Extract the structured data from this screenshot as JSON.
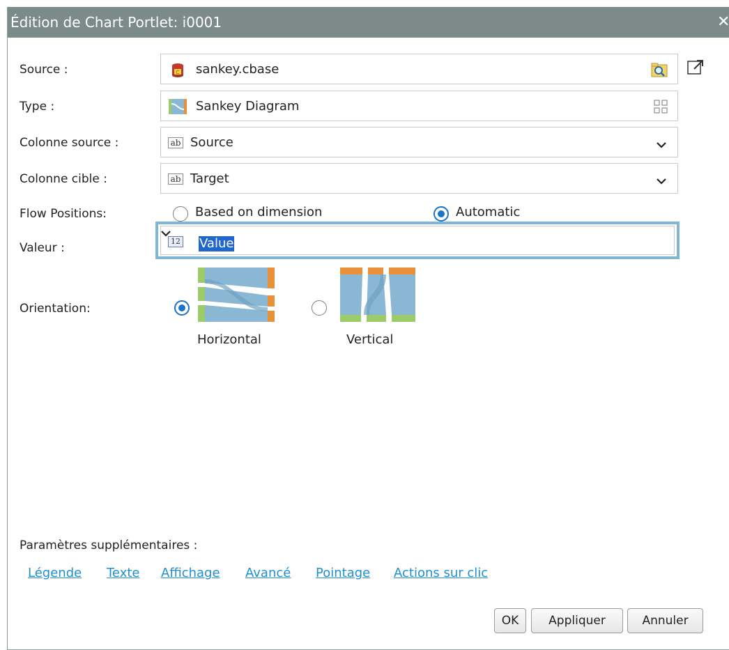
{
  "dialog": {
    "title": "Édition de Chart Portlet: i0001",
    "close_glyph": "✕"
  },
  "fields": {
    "source": {
      "label": "Source :",
      "value": "sankey.cbase",
      "icon": "database-icon",
      "browse_icon": "folder-search-icon",
      "external_icon": "open-external-icon"
    },
    "type": {
      "label": "Type :",
      "value": "Sankey Diagram",
      "icon": "sankey-chart-icon",
      "picker_icon": "grid-icon"
    },
    "colonne_source": {
      "label": "Colonne source :",
      "value": "Source",
      "type_badge": "ab"
    },
    "colonne_cible": {
      "label": "Colonne cible :",
      "value": "Target",
      "type_badge": "ab"
    },
    "flow_positions": {
      "label": "Flow Positions:",
      "options": [
        "Based on dimension",
        "Automatic"
      ],
      "selected": "Automatic"
    },
    "valeur": {
      "label": "Valeur :",
      "value": "Value",
      "type_badge": "12"
    },
    "orientation": {
      "label": "Orientation:",
      "options": [
        "Horizontal",
        "Vertical"
      ],
      "selected": "Horizontal"
    }
  },
  "extra": {
    "label": "Paramètres supplémentaires :",
    "links": [
      "Légende",
      "Texte",
      "Affichage",
      "Avancé",
      "Pointage",
      "Actions sur clic"
    ]
  },
  "buttons": {
    "ok": "OK",
    "apply": "Appliquer",
    "cancel": "Annuler"
  },
  "colors": {
    "titlebar": "#7c8b8a",
    "accent": "#1a73c8",
    "link": "#1f8fd0",
    "focus_ring": "#7fb6d3",
    "sankey_blue": "#8ab8d4",
    "sankey_orange": "#e8913a",
    "sankey_green": "#9ccb6a"
  }
}
